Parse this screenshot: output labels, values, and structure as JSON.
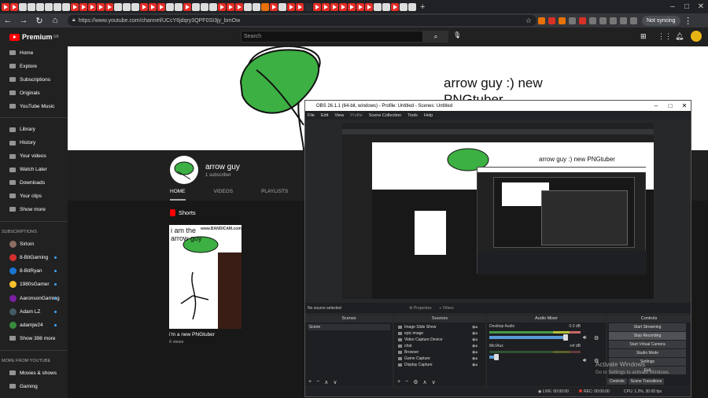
{
  "browser": {
    "url": "https://www.youtube.com/channel/UCcY6jdqry3QPF0SI3jy_bmOw",
    "sync_label": "Not syncing"
  },
  "youtube": {
    "logo": "Premium",
    "region": "GB",
    "search_placeholder": "Search",
    "sidebar": {
      "main": [
        {
          "label": "Home",
          "icon": "home-icon"
        },
        {
          "label": "Explore",
          "icon": "compass-icon"
        },
        {
          "label": "Subscriptions",
          "icon": "subscriptions-icon"
        },
        {
          "label": "Originals",
          "icon": "originals-icon"
        },
        {
          "label": "YouTube Music",
          "icon": "music-icon"
        }
      ],
      "library": [
        {
          "label": "Library",
          "icon": "library-icon"
        },
        {
          "label": "History",
          "icon": "history-icon"
        },
        {
          "label": "Your videos",
          "icon": "video-icon"
        },
        {
          "label": "Watch Later",
          "icon": "clock-icon"
        },
        {
          "label": "Downloads",
          "icon": "download-icon"
        },
        {
          "label": "Your clips",
          "icon": "scissors-icon"
        },
        {
          "label": "Show more",
          "icon": "chevron-down-icon"
        }
      ],
      "subscriptions_header": "SUBSCRIPTIONS",
      "channels": [
        {
          "label": "Sirloin",
          "color": "#8d6e63",
          "dot": false
        },
        {
          "label": "8-BitGaming",
          "color": "#d32f2f",
          "dot": true
        },
        {
          "label": "8-BitRyan",
          "color": "#1976d2",
          "dot": true
        },
        {
          "label": "1980sGamer",
          "color": "#fbc02d",
          "dot": true
        },
        {
          "label": "AaronsonGaming",
          "color": "#7b1fa2",
          "dot": true
        },
        {
          "label": "Adam LZ",
          "color": "#455a64",
          "dot": true
        },
        {
          "label": "adamjw24",
          "color": "#388e3c",
          "dot": true
        }
      ],
      "show_more_channels": "Show 398 more",
      "more_header": "MORE FROM YOUTUBE",
      "more": [
        {
          "label": "Movies & shows",
          "icon": "film-icon"
        },
        {
          "label": "Gaming",
          "icon": "gaming-icon"
        }
      ]
    },
    "banner_text": "arrow guy :) new PNGtuber",
    "channel": {
      "name": "arrow guy",
      "subscribers": "1 subscriber",
      "tabs": [
        "HOME",
        "VIDEOS",
        "PLAYLISTS"
      ],
      "shorts_label": "Shorts",
      "short": {
        "overlay": "i am the arrow guy",
        "watermark": "www.BANDICAM.com",
        "title": "i'm a new PNGtuber",
        "views": "6 views"
      }
    }
  },
  "obs": {
    "title": "OBS 26.1.1 (64-bit, windows) - Profile: Untitled - Scenes: Untitled",
    "menu": [
      "File",
      "Edit",
      "View",
      "Profile",
      "Scene Collection",
      "Tools",
      "Help"
    ],
    "no_source": "No source selected",
    "properties": "Properties",
    "filters": "Filters",
    "docks": {
      "scenes": {
        "title": "Scenes",
        "items": [
          "Scene"
        ]
      },
      "sources": {
        "title": "Sources",
        "items": [
          "Image Slide Show",
          "epic image",
          "Video Capture Device",
          "chat",
          "Browser",
          "Game Capture",
          "Display Capture"
        ]
      },
      "mixer": {
        "title": "Audio Mixer",
        "channels": [
          {
            "name": "Desktop Audio",
            "level": "0.0 dB",
            "volume": 0.84
          },
          {
            "name": "Mic/Aux",
            "level": "-inf dB",
            "volume": 0.08
          }
        ]
      },
      "controls": {
        "title": "Controls",
        "buttons": [
          "Start Streaming",
          "Stop Recording",
          "Start Virtual Camera",
          "Studio Mode",
          "Settings",
          "Exit"
        ],
        "tabs": [
          "Controls",
          "Scene Transitions"
        ]
      }
    },
    "status": {
      "live": "LIVE: 00:00:00",
      "rec": "REC: 00:00:00",
      "cpu": "CPU: 1.2%, 30.00 fps"
    }
  },
  "windows": {
    "activate_title": "Activate Windows",
    "activate_sub": "Go to Settings to activate Windows."
  }
}
